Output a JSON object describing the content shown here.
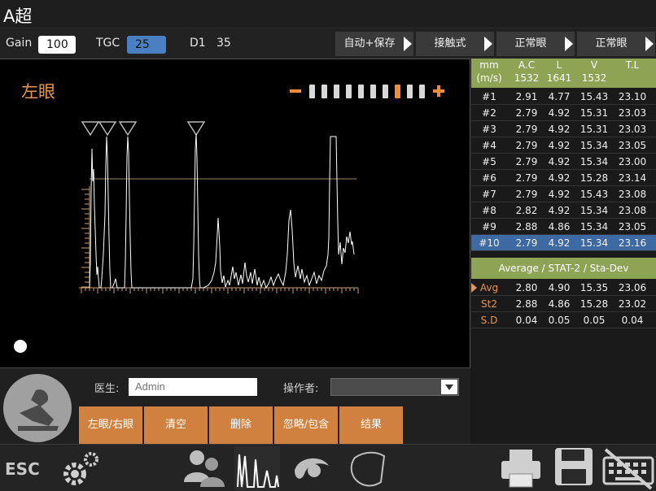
{
  "app": {
    "title": "A超"
  },
  "params": {
    "gain_label": "Gain",
    "gain_value": "100",
    "tgc_label": "TGC",
    "tgc_value": "25",
    "d1_label": "D1",
    "d1_value": "35"
  },
  "modes": [
    "自动+保存",
    "接触式",
    "正常眼",
    "正常眼"
  ],
  "scan": {
    "eye_label": "左眼",
    "gain_levels": 10,
    "gain_active_index": 7,
    "gate_color": "#b8b8b8",
    "axis_color": "#c8a070"
  },
  "table": {
    "headers": {
      "c0": "mm",
      "c0b": "(m/s)",
      "c1": "A.C",
      "c1b": "1532",
      "c2": "L",
      "c2b": "1641",
      "c3": "V",
      "c3b": "1532",
      "c4": "T.L"
    },
    "rows": [
      {
        "id": "#1",
        "ac": "2.91",
        "l": "4.77",
        "v": "15.43",
        "tl": "23.10"
      },
      {
        "id": "#2",
        "ac": "2.79",
        "l": "4.92",
        "v": "15.31",
        "tl": "23.03"
      },
      {
        "id": "#3",
        "ac": "2.79",
        "l": "4.92",
        "v": "15.31",
        "tl": "23.03"
      },
      {
        "id": "#4",
        "ac": "2.79",
        "l": "4.92",
        "v": "15.34",
        "tl": "23.05"
      },
      {
        "id": "#5",
        "ac": "2.79",
        "l": "4.92",
        "v": "15.34",
        "tl": "23.00"
      },
      {
        "id": "#6",
        "ac": "2.79",
        "l": "4.92",
        "v": "15.28",
        "tl": "23.14"
      },
      {
        "id": "#7",
        "ac": "2.79",
        "l": "4.92",
        "v": "15.43",
        "tl": "23.08"
      },
      {
        "id": "#8",
        "ac": "2.82",
        "l": "4.92",
        "v": "15.34",
        "tl": "23.08"
      },
      {
        "id": "#9",
        "ac": "2.88",
        "l": "4.86",
        "v": "15.34",
        "tl": "23.05"
      },
      {
        "id": "#10",
        "ac": "2.79",
        "l": "4.92",
        "v": "15.34",
        "tl": "23.16"
      }
    ],
    "selected_row": "#10",
    "stats_header": "Average / STAT-2 / Sta-Dev",
    "stats": [
      {
        "name": "Avg",
        "ac": "2.80",
        "l": "4.90",
        "v": "15.35",
        "tl": "23.06"
      },
      {
        "name": "St2",
        "ac": "2.88",
        "l": "4.86",
        "v": "15.28",
        "tl": "23.02"
      },
      {
        "name": "S.D",
        "ac": "0.04",
        "l": "0.05",
        "v": "0.05",
        "tl": "0.04"
      }
    ]
  },
  "controls": {
    "doctor_label": "医生:",
    "doctor_placeholder": "Admin",
    "operator_label": "操作者:",
    "operator_value": "",
    "buttons": [
      "左眼/右眼",
      "清空",
      "删除",
      "忽略/包含",
      "结果"
    ]
  },
  "bottom": {
    "esc_label": "ESC",
    "icons": [
      "settings-icon",
      "patients-icon",
      "a-scan-icon",
      "b-scan-icon",
      "biometry-icon",
      "print-icon",
      "save-icon",
      "keyboard-off-icon"
    ]
  },
  "colors": {
    "accent": "#d0813f",
    "table_header": "#8da454",
    "selected_row": "#3e6aa3"
  }
}
